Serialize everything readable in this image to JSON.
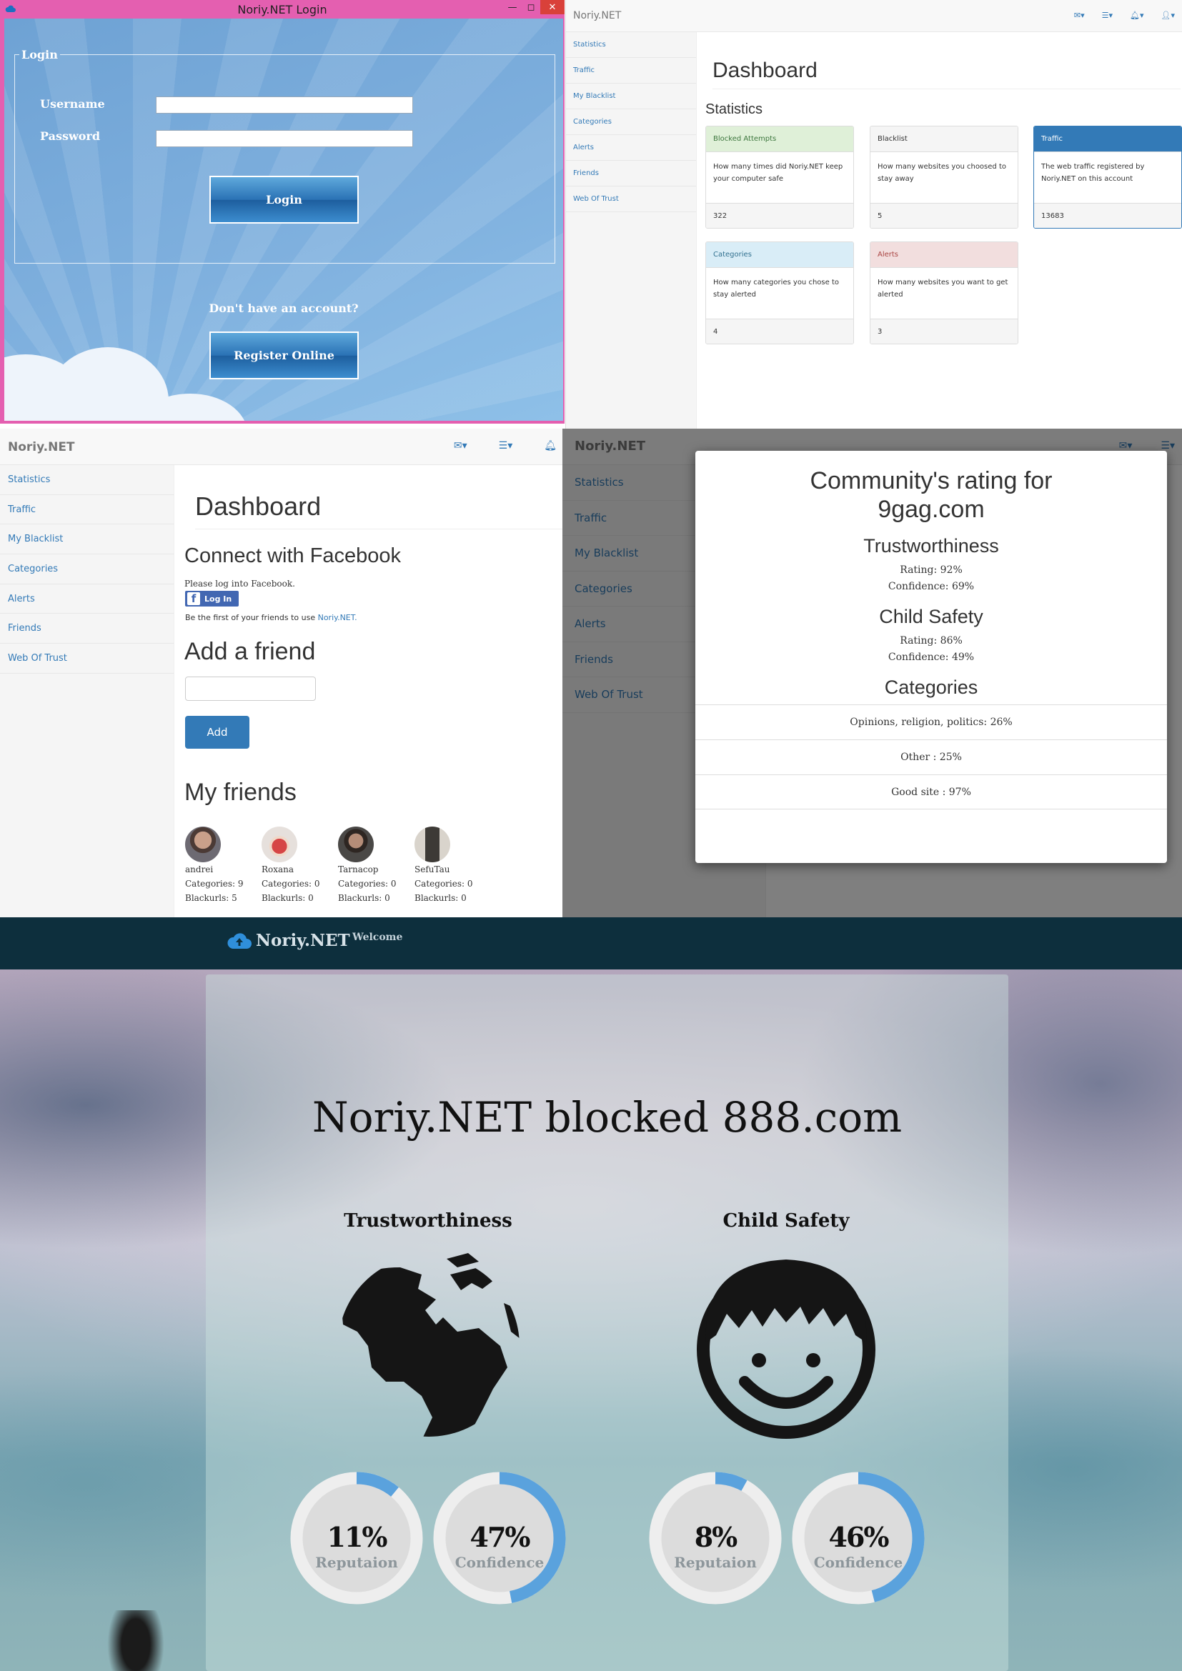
{
  "login_window": {
    "title": "Noriy.NET Login",
    "window_buttons": [
      "—",
      "◻",
      "✕"
    ],
    "legend": "Login",
    "username_label": "Username",
    "password_label": "Password",
    "username_value": "",
    "password_value": "",
    "login_button": "Login",
    "no_account_text": "Don't have an account?",
    "register_button": "Register Online"
  },
  "stats_dashboard": {
    "brand": "Noriy.NET",
    "sidebar": [
      "Statistics",
      "Traffic",
      "My Blacklist",
      "Categories",
      "Alerts",
      "Friends",
      "Web Of Trust"
    ],
    "page_title": "Dashboard",
    "section_title": "Statistics",
    "panels": [
      {
        "heading": "Blocked Attempts",
        "body": "How many times did Noriy.NET keep your computer safe",
        "value": "322",
        "color": "#3c763d",
        "bg": "#dff0d8"
      },
      {
        "heading": "Blacklist",
        "body": "How many websites you choosed to stay away",
        "value": "5",
        "color": "#333333",
        "bg": "#f5f5f5"
      },
      {
        "heading": "Traffic",
        "body": "The web traffic registered by Noriy.NET on this account",
        "value": "13683",
        "color": "#ffffff",
        "bg": "#337ab7"
      },
      {
        "heading": "Categories",
        "body": "How many categories you chose to stay alerted",
        "value": "4",
        "color": "#31708f",
        "bg": "#d9edf7"
      },
      {
        "heading": "Alerts",
        "body": "How many websites you want to get alerted",
        "value": "3",
        "color": "#a94442",
        "bg": "#f2dede"
      }
    ]
  },
  "friends_dashboard": {
    "brand": "Noriy.NET",
    "sidebar": [
      "Statistics",
      "Traffic",
      "My Blacklist",
      "Categories",
      "Alerts",
      "Friends",
      "Web Of Trust"
    ],
    "page_title": "Dashboard",
    "facebook_title": "Connect with Facebook",
    "facebook_prompt": "Please log into Facebook.",
    "facebook_login": "Log In",
    "first_friends_text": "Be the first of your friends to use",
    "first_friends_link": "Noriy.NET.",
    "add_friend_title": "Add a friend",
    "add_friend_value": "",
    "add_button": "Add",
    "my_friends_title": "My friends",
    "friends": [
      {
        "name": "andrei",
        "categories": "Categories: 9",
        "blackurls": "Blackurls: 5"
      },
      {
        "name": "Roxana",
        "categories": "Categories: 0",
        "blackurls": "Blackurls: 0"
      },
      {
        "name": "Tarnacop",
        "categories": "Categories: 0",
        "blackurls": "Blackurls: 0"
      },
      {
        "name": "SefuTau",
        "categories": "Categories: 0",
        "blackurls": "Blackurls: 0"
      }
    ]
  },
  "rating_modal": {
    "brand": "Noriy.NET",
    "sidebar": [
      "Statistics",
      "Traffic",
      "My Blacklist",
      "Categories",
      "Alerts",
      "Friends",
      "Web Of Trust"
    ],
    "title_line1": "Community's rating for",
    "title_line2": "9gag.com",
    "trust_title": "Trustworthiness",
    "trust_rating": "Rating: 92%",
    "trust_confidence": "Confidence: 69%",
    "child_title": "Child Safety",
    "child_rating": "Rating: 86%",
    "child_confidence": "Confidence: 49%",
    "categories_title": "Categories",
    "categories": [
      "Opinions, religion, politics: 26%",
      "Other : 25%",
      "Good site : 97%"
    ]
  },
  "blocked_page": {
    "logo_text": "Noriy.NET",
    "nav_welcome": "Welcome",
    "headline": "Noriy.NET blocked 888.com",
    "trust_title": "Trustworthiness",
    "child_title": "Child Safety",
    "gauges": [
      {
        "value_text": "11%",
        "label": "Reputaion",
        "fraction": 0.11
      },
      {
        "value_text": "47%",
        "label": "Confidence",
        "fraction": 0.47
      },
      {
        "value_text": "8%",
        "label": "Reputaion",
        "fraction": 0.08
      },
      {
        "value_text": "46%",
        "label": "Confidence",
        "fraction": 0.46
      }
    ],
    "gauge_color": "#5aa2dd",
    "gauge_track_color": "#eeeeee"
  }
}
